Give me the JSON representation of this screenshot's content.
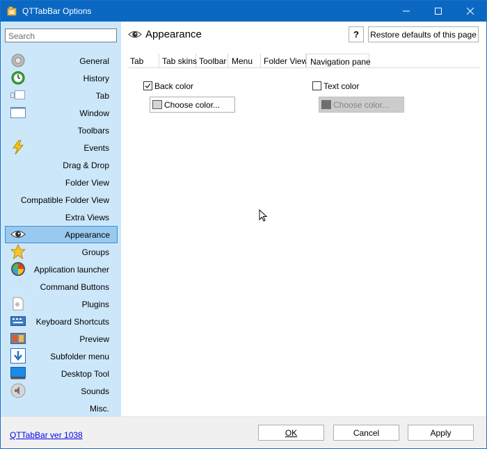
{
  "window": {
    "title": "QTTabBar Options",
    "title_bar_color": "#0b68c2"
  },
  "sidebar": {
    "search_placeholder": "Search",
    "background": "#cde7fa",
    "items": [
      {
        "label": "General",
        "icon": "gear-icon"
      },
      {
        "label": "History",
        "icon": "history-icon"
      },
      {
        "label": "Tab",
        "icon": "tab-icon"
      },
      {
        "label": "Window",
        "icon": "window-icon"
      },
      {
        "label": "Toolbars",
        "icon": ""
      },
      {
        "label": "Events",
        "icon": "lightning-icon"
      },
      {
        "label": "Drag & Drop",
        "icon": ""
      },
      {
        "label": "Folder View",
        "icon": ""
      },
      {
        "label": "Compatible Folder View",
        "icon": ""
      },
      {
        "label": "Extra Views",
        "icon": ""
      },
      {
        "label": "Appearance",
        "icon": "eye-icon",
        "selected": true
      },
      {
        "label": "Groups",
        "icon": "star-icon"
      },
      {
        "label": "Application launcher",
        "icon": "app-launcher-icon"
      },
      {
        "label": "Command Buttons",
        "icon": ""
      },
      {
        "label": "Plugins",
        "icon": "plugin-icon"
      },
      {
        "label": "Keyboard Shortcuts",
        "icon": "keyboard-icon"
      },
      {
        "label": "Preview",
        "icon": "preview-icon"
      },
      {
        "label": "Subfolder menu",
        "icon": "subfolder-icon"
      },
      {
        "label": "Desktop Tool",
        "icon": "desktop-icon"
      },
      {
        "label": "Sounds",
        "icon": "sound-icon"
      },
      {
        "label": "Misc.",
        "icon": ""
      }
    ]
  },
  "header": {
    "title": "Appearance",
    "help_label": "?",
    "restore_label": "Restore defaults of this page"
  },
  "tabs": [
    {
      "label": "Tab"
    },
    {
      "label": "Tab skins"
    },
    {
      "label": "Toolbar"
    },
    {
      "label": "Menu"
    },
    {
      "label": "Folder View"
    },
    {
      "label": "Navigation pane",
      "active": true
    }
  ],
  "content": {
    "back_color": {
      "label": "Back color",
      "checked": true,
      "button": "Choose color..."
    },
    "text_color": {
      "label": "Text color",
      "checked": false,
      "button": "Choose color..."
    }
  },
  "footer": {
    "version": "QTTabBar ver 1038",
    "ok": "OK",
    "cancel": "Cancel",
    "apply": "Apply"
  }
}
